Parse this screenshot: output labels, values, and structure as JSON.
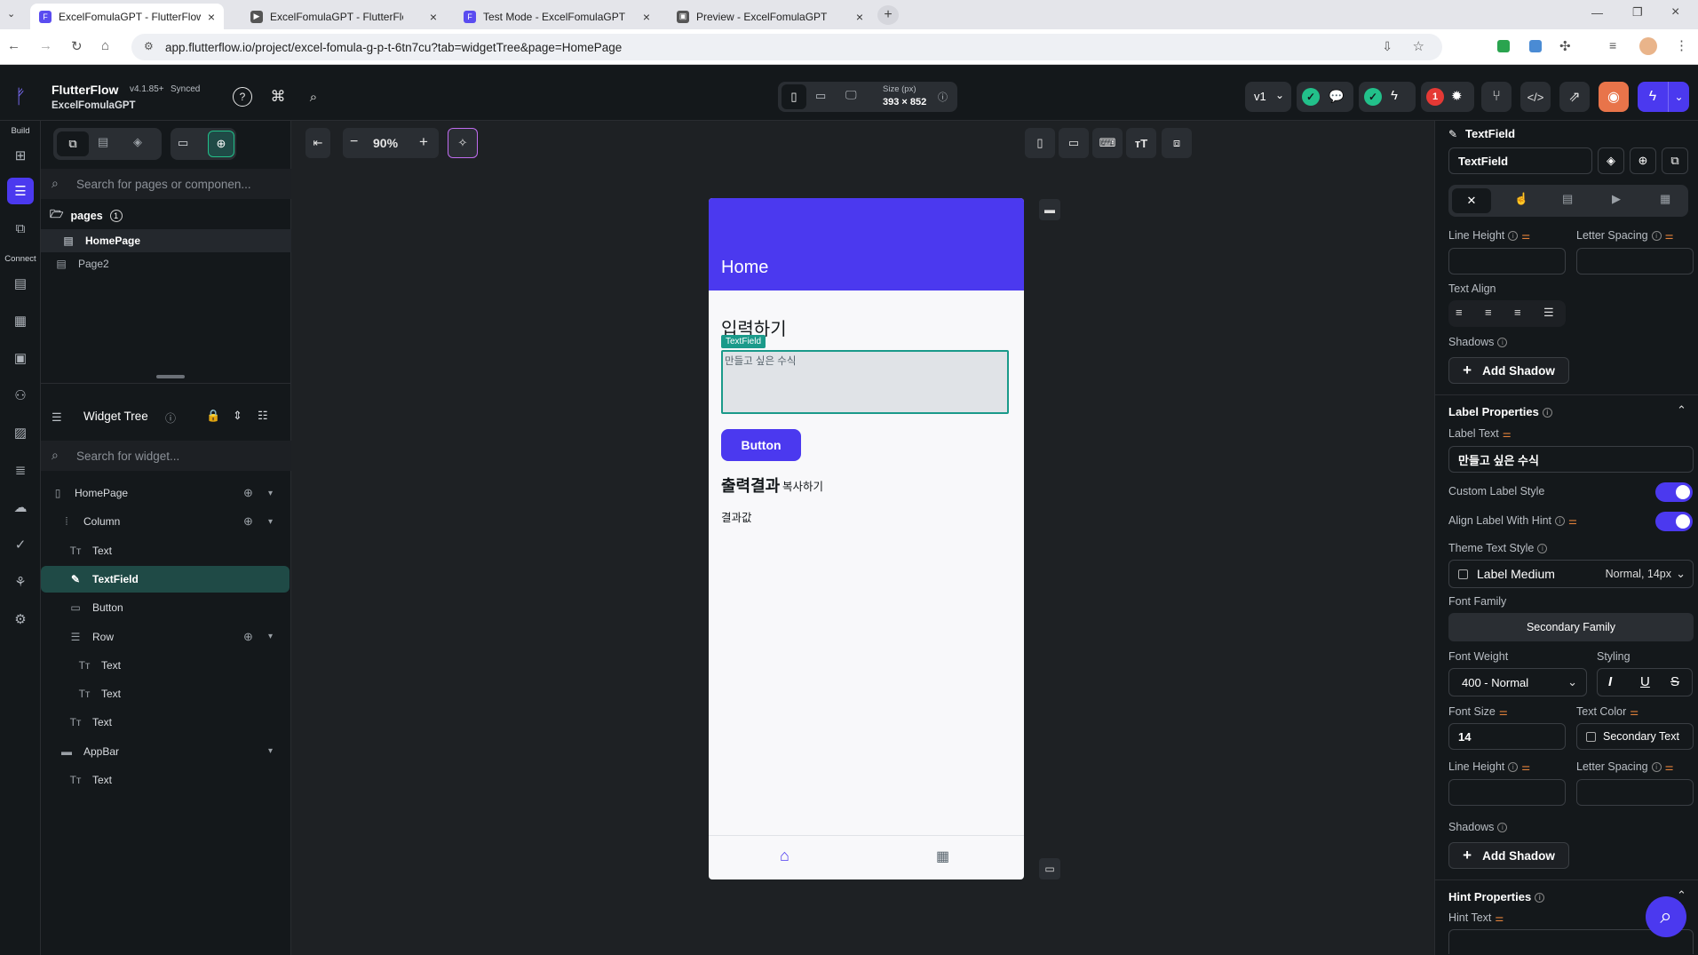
{
  "browser": {
    "tabs": [
      {
        "title": "ExcelFomulaGPT - FlutterFlow",
        "active": true
      },
      {
        "title": "ExcelFomulaGPT - FlutterFlo",
        "active": false
      },
      {
        "title": "Test Mode - ExcelFomulaGPT",
        "active": false
      },
      {
        "title": "Preview - ExcelFomulaGPT",
        "active": false
      }
    ],
    "url": "app.flutterflow.io/project/excel-fomula-g-p-t-6tn7cu?tab=widgetTree&page=HomePage"
  },
  "header": {
    "brand": "FlutterFlow",
    "version": "v4.1.85+",
    "sync_status": "Synced",
    "project": "ExcelFomulaGPT",
    "size_label": "Size (px)",
    "size_value": "393 × 852",
    "version_selector": "v1",
    "error_count": "1"
  },
  "rail": {
    "build_label": "Build",
    "connect_label": "Connect"
  },
  "left_panel": {
    "page_search_placeholder": "Search for pages or componen...",
    "pages_label": "pages",
    "pages_count": "1",
    "pages": [
      "HomePage",
      "Page2"
    ],
    "widget_tree_title": "Widget Tree",
    "widget_search_placeholder": "Search for widget...",
    "tree": [
      {
        "label": "HomePage",
        "icon": "phone-icon",
        "level": 0
      },
      {
        "label": "Column",
        "icon": "column-icon",
        "level": 1
      },
      {
        "label": "Text",
        "icon": "text-icon",
        "level": 2
      },
      {
        "label": "TextField",
        "icon": "textfield-icon",
        "level": 2,
        "selected": true
      },
      {
        "label": "Button",
        "icon": "button-icon",
        "level": 2
      },
      {
        "label": "Row",
        "icon": "row-icon",
        "level": 2
      },
      {
        "label": "Text",
        "icon": "text-icon",
        "level": 3
      },
      {
        "label": "Text",
        "icon": "text-icon",
        "level": 3
      },
      {
        "label": "Text",
        "icon": "text-icon",
        "level": 2
      },
      {
        "label": "AppBar",
        "icon": "appbar-icon",
        "level": 1
      },
      {
        "label": "Text",
        "icon": "text-icon",
        "level": 2
      }
    ]
  },
  "canvas": {
    "zoom": "90%",
    "phone": {
      "appbar_title": "Home",
      "input_heading": "입력하기",
      "textfield_tag": "TextField",
      "textfield_label": "만들고 싶은 수식",
      "button_label": "Button",
      "output_heading": "출력결과",
      "copy_label": "복사하기",
      "result_label": "결과값"
    }
  },
  "right_panel": {
    "widget_type": "TextField",
    "widget_name": "TextField",
    "line_height_label": "Line Height",
    "letter_spacing_label": "Letter Spacing",
    "text_align_label": "Text Align",
    "shadows_label": "Shadows",
    "add_shadow_label": "Add Shadow",
    "label_properties_title": "Label Properties",
    "label_text_label": "Label Text",
    "label_text_value": "만들고 싶은 수식",
    "custom_label_style_label": "Custom Label Style",
    "align_label_with_hint_label": "Align Label With Hint",
    "theme_text_style_label": "Theme Text Style",
    "theme_text_style_value": "Label Medium",
    "theme_text_style_meta": "Normal, 14px",
    "font_family_label": "Font Family",
    "font_family_value": "Secondary Family",
    "font_weight_label": "Font Weight",
    "font_weight_value": "400 - Normal",
    "styling_label": "Styling",
    "font_size_label": "Font Size",
    "font_size_value": "14",
    "text_color_label": "Text Color",
    "text_color_value": "Secondary Text",
    "line_height_label_2": "Line Height",
    "letter_spacing_label_2": "Letter Spacing",
    "shadows_label_2": "Shadows",
    "add_shadow_label_2": "Add Shadow",
    "hint_properties_title": "Hint Properties",
    "hint_text_label": "Hint Text"
  },
  "colors": {
    "accent": "#4b39ef",
    "selected_tree": "#1f4a46",
    "success": "#22c08a",
    "error": "#e53935",
    "textfield_border": "#1a9a8a"
  }
}
